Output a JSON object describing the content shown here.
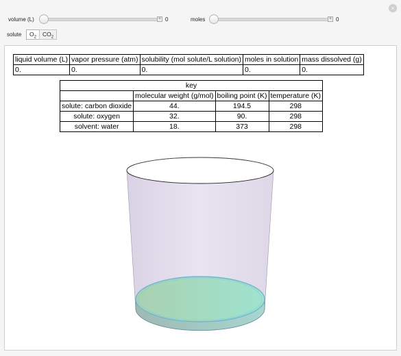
{
  "controls": {
    "volume_label": "volume (L)",
    "volume_value": "0",
    "volume_fraction": 0,
    "moles_label": "moles",
    "moles_value": "0",
    "moles_fraction": 0,
    "solute_label": "solute",
    "solute_options": [
      "O2",
      "CO2"
    ],
    "solute_selected": "O2"
  },
  "results_table": {
    "headers": [
      "liquid volume (L)",
      "vapor pressure (atm)",
      "solubility (mol solute/L solution)",
      "moles in solution",
      "mass dissolved (g)"
    ],
    "values": [
      "0.",
      "0.",
      "0.",
      "0.",
      "0."
    ]
  },
  "key_table": {
    "title": "key",
    "headers": [
      "molecular weight (g/mol)",
      "boiling point (K)",
      "temperature (K)"
    ],
    "rows": [
      {
        "label": "solute: carbon dioxide",
        "cells": [
          "44.",
          "194.5",
          "298"
        ]
      },
      {
        "label": "solute: oxygen",
        "cells": [
          "32.",
          "90.",
          "298"
        ]
      },
      {
        "label": "solvent: water",
        "cells": [
          "18.",
          "373",
          "298"
        ]
      }
    ]
  },
  "colors": {
    "glass": "#e2dcea",
    "liquid_left": "#a9d1b1",
    "liquid_right": "#9fe3cf",
    "liquid_edge": "#6fb7cf",
    "background": "#f5f5f5",
    "panel": "#ffffff"
  }
}
